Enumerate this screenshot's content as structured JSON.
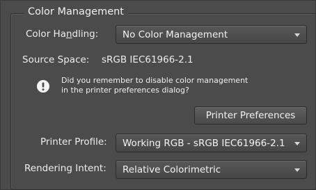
{
  "section": {
    "title": "Color Management"
  },
  "color_handling": {
    "label_before": "Color Ha",
    "label_accel": "n",
    "label_after": "dling:",
    "value": "No Color Management"
  },
  "source_space": {
    "label": "Source Space:",
    "value": "sRGB IEC61966-2.1"
  },
  "note": {
    "line1": "Did you remember to disable color management",
    "line2": "in the printer preferences dialog?"
  },
  "printer_preferences_button": {
    "label": "Printer Preferences"
  },
  "printer_profile": {
    "label": "Printer Profile:",
    "value": "Working RGB - sRGB IEC61966-2.1"
  },
  "rendering_intent": {
    "label": "Rendering Intent:",
    "value": "Relative Colorimetric"
  },
  "icons": {
    "info": "exclamation-info-icon",
    "dropdown": "chevron-down-icon"
  },
  "colors": {
    "panel_bg": "#4b4b4b",
    "text": "#ececec",
    "border": "#2c2c2c"
  }
}
